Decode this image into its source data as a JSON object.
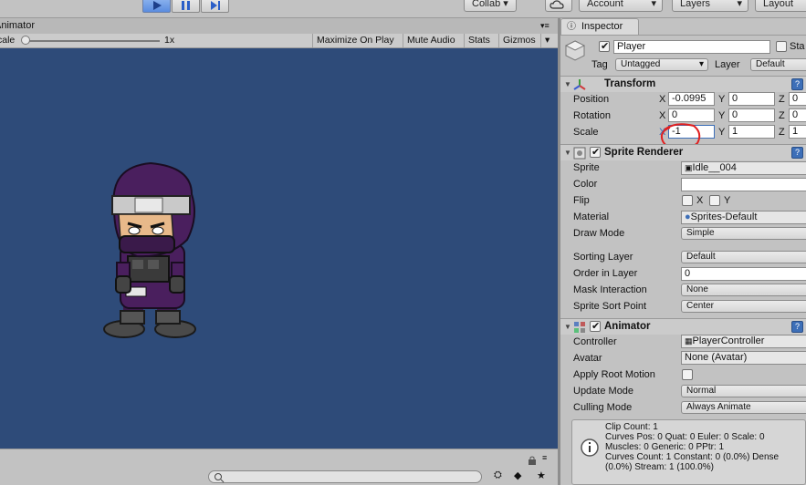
{
  "toolbar": {
    "collab_label": "Collab",
    "account_label": "Account",
    "layers_label": "Layers",
    "layout_label": "Layout"
  },
  "game": {
    "tab_label": "Animator",
    "scale_label": "cale",
    "scale_value": "1x",
    "maximize_label": "Maximize On Play",
    "mute_label": "Mute Audio",
    "stats_label": "Stats",
    "gizmos_label": "Gizmos",
    "background_color": "#2e4b79"
  },
  "inspector": {
    "tab_label": "Inspector",
    "object_name": "Player",
    "static_label": "Sta",
    "tag_label": "Tag",
    "tag_value": "Untagged",
    "layer_label": "Layer",
    "layer_value": "Default",
    "transform": {
      "title": "Transform",
      "position_label": "Position",
      "rotation_label": "Rotation",
      "scale_label": "Scale",
      "x": "X",
      "y": "Y",
      "z": "Z",
      "position": [
        "-0.0995",
        "0",
        "0"
      ],
      "rotation": [
        "0",
        "0",
        "0"
      ],
      "scale": [
        "-1",
        "1",
        "1"
      ]
    },
    "sprite_renderer": {
      "title": "Sprite Renderer",
      "sprite_label": "Sprite",
      "sprite_value": "Idle__004",
      "color_label": "Color",
      "flip_label": "Flip",
      "flip_x": "X",
      "flip_y": "Y",
      "material_label": "Material",
      "material_value": "Sprites-Default",
      "draw_mode_label": "Draw Mode",
      "draw_mode_value": "Simple",
      "sorting_layer_label": "Sorting Layer",
      "sorting_layer_value": "Default",
      "order_label": "Order in Layer",
      "order_value": "0",
      "mask_label": "Mask Interaction",
      "mask_value": "None",
      "sort_point_label": "Sprite Sort Point",
      "sort_point_value": "Center"
    },
    "animator": {
      "title": "Animator",
      "controller_label": "Controller",
      "controller_value": "PlayerController",
      "avatar_label": "Avatar",
      "avatar_value": "None (Avatar)",
      "root_motion_label": "Apply Root Motion",
      "update_label": "Update Mode",
      "update_value": "Normal",
      "culling_label": "Culling Mode",
      "culling_value": "Always Animate",
      "info": "Clip Count: 1\nCurves Pos: 0 Quat: 0 Euler: 0 Scale: 0\nMuscles: 0 Generic: 0 PPtr: 1\nCurves Count: 1 Constant: 0 (0.0%) Dense\n(0.0%) Stream: 1 (100.0%)"
    }
  },
  "colors": {
    "accent": "#3d6fb8",
    "annotation": "#e02020"
  }
}
